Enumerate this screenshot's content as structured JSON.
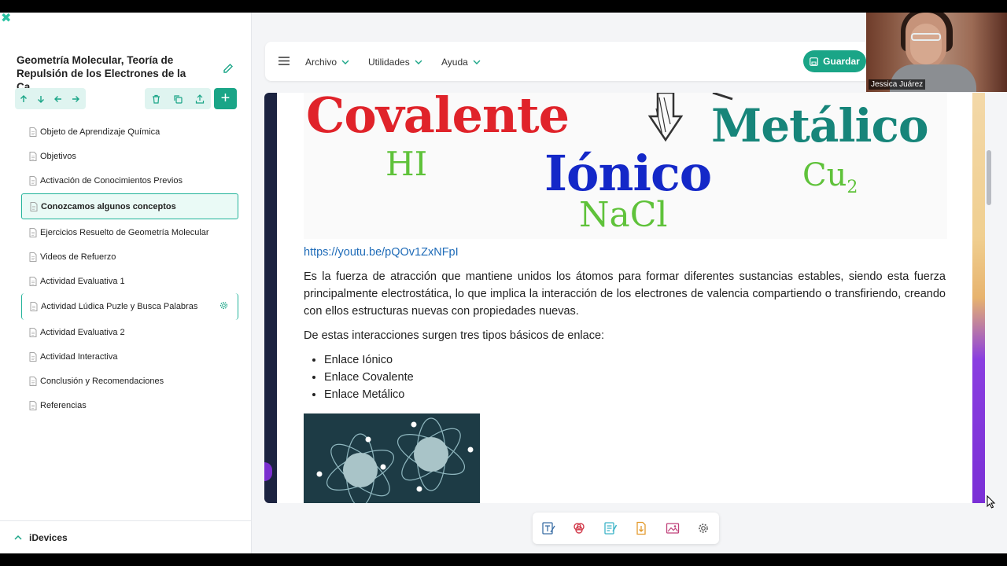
{
  "project": {
    "title": "Geometría Molecular, Teoría de Repulsión de los Electrones de la Ca..."
  },
  "nav": {
    "items": [
      {
        "label": "Objeto de Aprendizaje Química",
        "state": "normal"
      },
      {
        "label": "Objetivos",
        "state": "normal"
      },
      {
        "label": "Activación de Conocimientos Previos",
        "state": "normal"
      },
      {
        "label": "Conozcamos algunos conceptos",
        "state": "active"
      },
      {
        "label": "Ejercicios Resuelto de Geometría Molecular",
        "state": "normal"
      },
      {
        "label": "Videos de Refuerzo",
        "state": "normal"
      },
      {
        "label": "Actividad Evaluativa 1",
        "state": "normal"
      },
      {
        "label": "Actividad Lúdica Puzle y Busca Palabras",
        "state": "hover"
      },
      {
        "label": "Actividad Evaluativa 2",
        "state": "normal"
      },
      {
        "label": "Actividad Interactiva",
        "state": "normal"
      },
      {
        "label": "Conclusión y Recomendaciones",
        "state": "normal"
      },
      {
        "label": "Referencias",
        "state": "normal"
      }
    ]
  },
  "idevices": {
    "label": "iDevices"
  },
  "menu": {
    "archivo": "Archivo",
    "utilidades": "Utilidades",
    "ayuda": "Ayuda",
    "save": "Guardar"
  },
  "webcam": {
    "name": "Jessica Juárez"
  },
  "banner": {
    "covalente": "Covalente",
    "hi": "HI",
    "ionico": "Iónico",
    "nacl": "NaCl",
    "metalico": "Metálico",
    "cu": "Cu",
    "cu_sub": "2"
  },
  "article": {
    "link": "https://youtu.be/pQOv1ZxNFpI",
    "para1": "Es la fuerza de atracción que mantiene unidos los átomos para formar diferentes sustancias estables, siendo esta fuerza principalmente electrostática, lo que implica la interacción de los electrones de valencia compartiendo o transfiriendo, creando con ellos estructuras nuevas con propiedades nuevas.",
    "para2": "De estas interacciones surgen tres tipos básicos de enlace:",
    "bullets": [
      "Enlace Iónico",
      "Enlace Covalente",
      "Enlace Metálico"
    ]
  },
  "colors": {
    "accent": "#1aa587",
    "link": "#1e6bb8"
  }
}
